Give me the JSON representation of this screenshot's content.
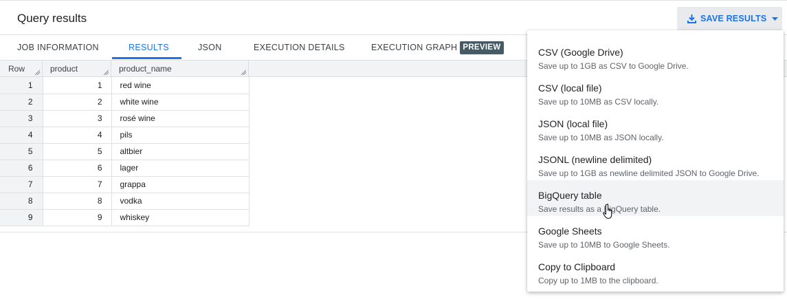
{
  "header": {
    "title": "Query results",
    "save_label": "SAVE RESULTS"
  },
  "tabs": [
    {
      "label": "JOB INFORMATION"
    },
    {
      "label": "RESULTS",
      "active": true
    },
    {
      "label": "JSON"
    },
    {
      "label": "EXECUTION DETAILS"
    },
    {
      "label": "EXECUTION GRAPH",
      "badge": "PREVIEW"
    }
  ],
  "grid": {
    "columns": [
      "Row",
      "product",
      "product_name"
    ],
    "rows": [
      {
        "row": "1",
        "product": "1",
        "product_name": "red wine"
      },
      {
        "row": "2",
        "product": "2",
        "product_name": "white wine"
      },
      {
        "row": "3",
        "product": "3",
        "product_name": "rosé wine"
      },
      {
        "row": "4",
        "product": "4",
        "product_name": "pils"
      },
      {
        "row": "5",
        "product": "5",
        "product_name": "altbier"
      },
      {
        "row": "6",
        "product": "6",
        "product_name": "lager"
      },
      {
        "row": "7",
        "product": "7",
        "product_name": "grappa"
      },
      {
        "row": "8",
        "product": "8",
        "product_name": "vodka"
      },
      {
        "row": "9",
        "product": "9",
        "product_name": "whiskey"
      }
    ]
  },
  "save_menu": {
    "items": [
      {
        "label": "CSV (Google Drive)",
        "desc": "Save up to 1GB as CSV to Google Drive."
      },
      {
        "label": "CSV (local file)",
        "desc": "Save up to 10MB as CSV locally."
      },
      {
        "label": "JSON (local file)",
        "desc": "Save up to 10MB as JSON locally."
      },
      {
        "label": "JSONL (newline delimited)",
        "desc": "Save up to 1GB as newline delimited JSON to Google Drive."
      },
      {
        "label": "BigQuery table",
        "desc": "Save results as a BigQuery table.",
        "hovered": true
      },
      {
        "label": "Google Sheets",
        "desc": "Save up to 10MB to Google Sheets."
      },
      {
        "label": "Copy to Clipboard",
        "desc": "Copy up to 1MB to the clipboard."
      }
    ]
  },
  "colors": {
    "accent": "#1a73e8",
    "badge_bg": "#455a64",
    "header_bg": "#f1f3f4"
  },
  "icons": {
    "save": "download-icon",
    "dropdown": "caret-down-icon",
    "column_resize": "resize-handle-icon",
    "cursor": "hand-pointer-cursor"
  }
}
